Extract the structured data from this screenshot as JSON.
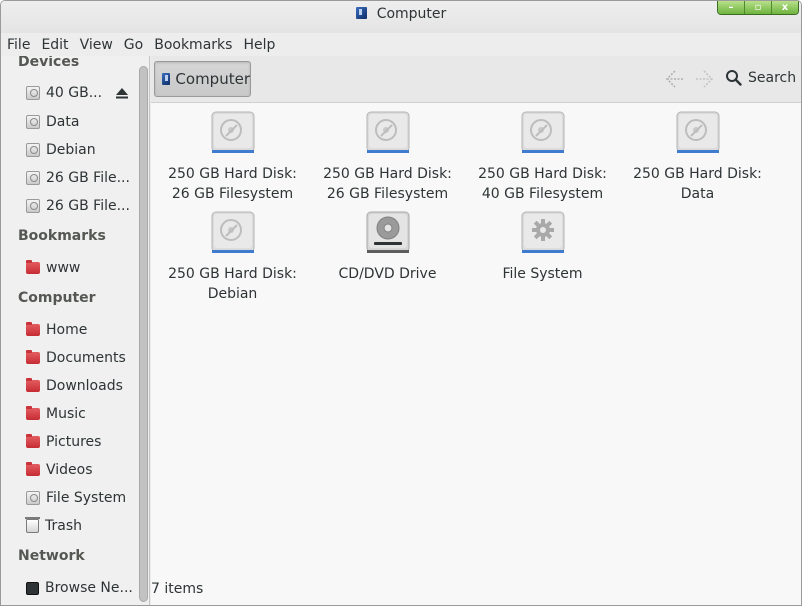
{
  "window": {
    "title": "Computer",
    "controls": {
      "minimize": "–",
      "maximize": "▫",
      "close": "x"
    }
  },
  "menubar": {
    "items": [
      "File",
      "Edit",
      "View",
      "Go",
      "Bookmarks",
      "Help"
    ]
  },
  "sidebar": {
    "sections": {
      "devices": "Devices",
      "bookmarks": "Bookmarks",
      "computer": "Computer",
      "network": "Network"
    },
    "devices": [
      {
        "label": "40 GB...",
        "icon": "drive-icon"
      },
      {
        "label": "Data",
        "icon": "drive-icon"
      },
      {
        "label": "Debian",
        "icon": "drive-icon"
      },
      {
        "label": "26 GB File...",
        "icon": "drive-icon"
      },
      {
        "label": "26 GB File...",
        "icon": "drive-icon"
      }
    ],
    "bookmarks": [
      {
        "label": "www",
        "icon": "folder-icon"
      }
    ],
    "computer": [
      {
        "label": "Home",
        "icon": "home-folder-icon"
      },
      {
        "label": "Documents",
        "icon": "documents-folder-icon"
      },
      {
        "label": "Downloads",
        "icon": "downloads-folder-icon"
      },
      {
        "label": "Music",
        "icon": "music-folder-icon"
      },
      {
        "label": "Pictures",
        "icon": "pictures-folder-icon"
      },
      {
        "label": "Videos",
        "icon": "videos-folder-icon"
      },
      {
        "label": "File System",
        "icon": "drive-icon"
      },
      {
        "label": "Trash",
        "icon": "trash-icon"
      }
    ],
    "network": [
      {
        "label": "Browse Ne...",
        "icon": "network-icon"
      }
    ]
  },
  "toolbar": {
    "path_button": "Computer",
    "search_label": "Search"
  },
  "content": {
    "items": [
      {
        "line1": "250 GB Hard Disk:",
        "line2": "26 GB Filesystem",
        "icon": "hard-disk-icon"
      },
      {
        "line1": "250 GB Hard Disk:",
        "line2": "26 GB Filesystem",
        "icon": "hard-disk-icon"
      },
      {
        "line1": "250 GB Hard Disk:",
        "line2": "40 GB Filesystem",
        "icon": "hard-disk-icon"
      },
      {
        "line1": "250 GB Hard Disk:",
        "line2": "Data",
        "icon": "hard-disk-icon"
      },
      {
        "line1": "250 GB Hard Disk:",
        "line2": "Debian",
        "icon": "hard-disk-icon"
      },
      {
        "line1": "CD/DVD Drive",
        "line2": "",
        "icon": "optical-drive-icon"
      },
      {
        "line1": "File System",
        "line2": "",
        "icon": "file-system-icon"
      }
    ]
  },
  "statusbar": {
    "text": "7 items"
  },
  "colors": {
    "folder_red": "#d13f45",
    "wm_green": "#7cbd4a",
    "content_bg": "#f8f8f8",
    "sidebar_bg": "#f0f0f0"
  }
}
